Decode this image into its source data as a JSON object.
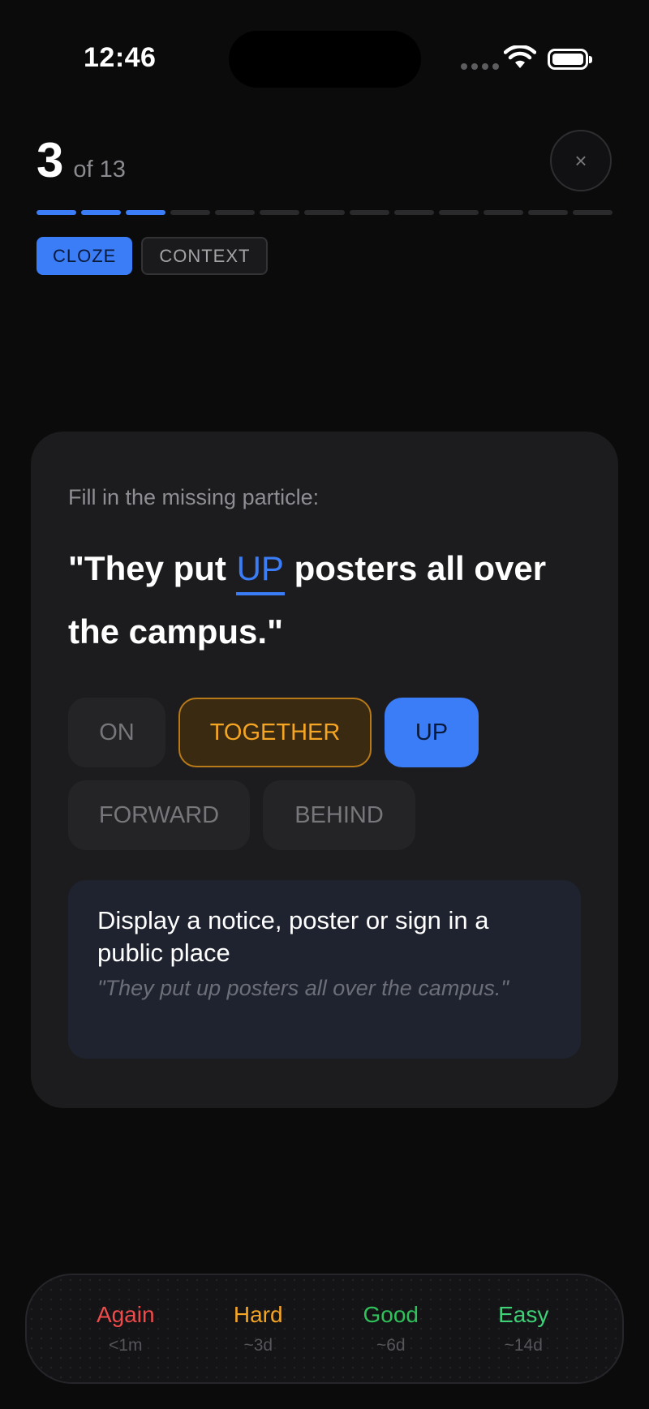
{
  "status": {
    "time": "12:46"
  },
  "progress": {
    "current": "3",
    "of_label": "of",
    "total": "13",
    "completed_segments": 3,
    "total_segments": 13
  },
  "close": {
    "symbol": "×"
  },
  "tabs": [
    {
      "label": "CLOZE",
      "active": true
    },
    {
      "label": "CONTEXT",
      "active": false
    }
  ],
  "card": {
    "prompt": "Fill in the missing particle:",
    "sentence_before": "\"They put ",
    "answer": "UP",
    "sentence_after": " posters all over the campus.\"",
    "options": [
      "ON",
      "TOGETHER",
      "UP",
      "FORWARD",
      "BEHIND"
    ],
    "wrong_choice": "TOGETHER",
    "correct_choice": "UP",
    "definition": "Display a notice, poster or sign in a public place",
    "example": "\"They put up posters all over the campus.\""
  },
  "ratings": [
    {
      "label": "Again",
      "interval": "<1m",
      "color": "#ef4b4b"
    },
    {
      "label": "Hard",
      "interval": "~3d",
      "color": "#f5a524"
    },
    {
      "label": "Good",
      "interval": "~6d",
      "color": "#2fc25b"
    },
    {
      "label": "Easy",
      "interval": "~14d",
      "color": "#3ed178"
    }
  ],
  "colors": {
    "accent": "#3b7cf7",
    "warning": "#f5a524",
    "background": "#0b0b0c",
    "card": "#1c1c1e"
  }
}
